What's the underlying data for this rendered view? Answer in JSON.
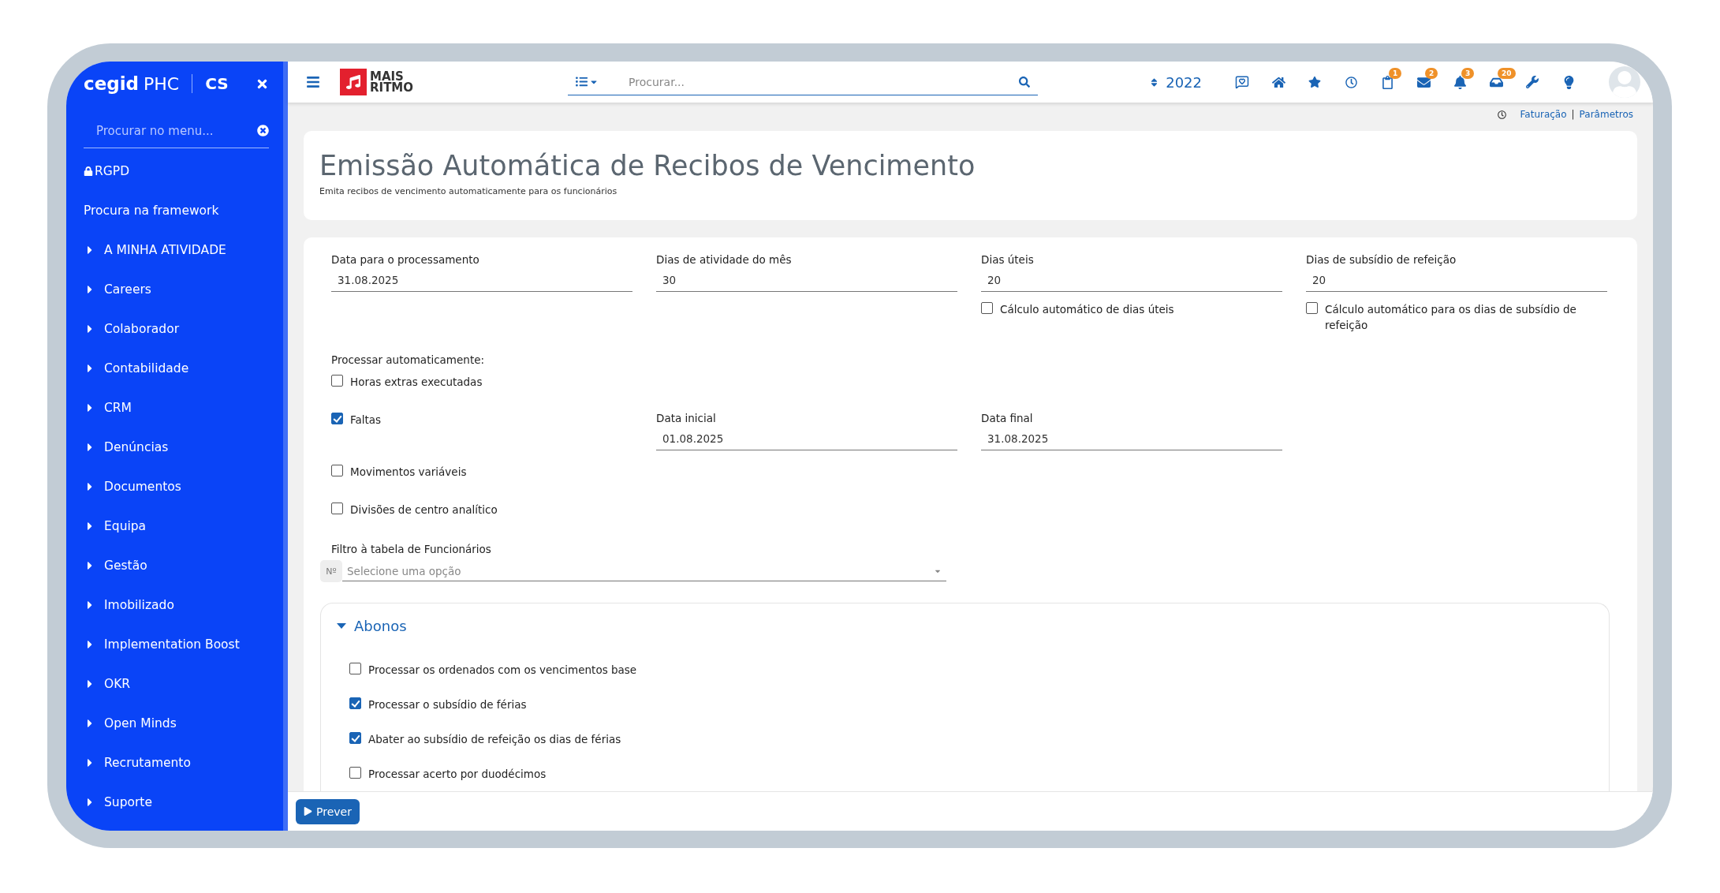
{
  "sidebar": {
    "brand": {
      "name": "cegid",
      "product": "PHC",
      "edition": "CS"
    },
    "search": {
      "placeholder": "Procurar no menu..."
    },
    "items": [
      {
        "label": "RGPD",
        "kind": "locked"
      },
      {
        "label": "Procura na framework",
        "kind": "link"
      },
      {
        "label": "A MINHA ATIVIDADE",
        "kind": "group",
        "expanded": false
      },
      {
        "label": "Careers",
        "kind": "group",
        "expanded": false
      },
      {
        "label": "Colaborador",
        "kind": "group",
        "expanded": false
      },
      {
        "label": "Contabilidade",
        "kind": "group",
        "expanded": false
      },
      {
        "label": "CRM",
        "kind": "group",
        "expanded": false
      },
      {
        "label": "Denúncias",
        "kind": "group",
        "expanded": false
      },
      {
        "label": "Documentos",
        "kind": "group",
        "expanded": false
      },
      {
        "label": "Equipa",
        "kind": "group",
        "expanded": false
      },
      {
        "label": "Gestão",
        "kind": "group",
        "expanded": false
      },
      {
        "label": "Imobilizado",
        "kind": "group",
        "expanded": false
      },
      {
        "label": "Implementation Boost",
        "kind": "group",
        "expanded": false
      },
      {
        "label": "OKR",
        "kind": "group",
        "expanded": false
      },
      {
        "label": "Open Minds",
        "kind": "group",
        "expanded": false
      },
      {
        "label": "Recrutamento",
        "kind": "group",
        "expanded": false
      },
      {
        "label": "Suporte",
        "kind": "group",
        "expanded": false
      }
    ]
  },
  "topbar": {
    "logo": {
      "line_1": "MAIS",
      "line_2": "RITMO"
    },
    "search": {
      "placeholder": "Procurar..."
    },
    "year": "2022",
    "icons": [
      {
        "kind": "message"
      },
      {
        "kind": "home"
      },
      {
        "kind": "star"
      },
      {
        "kind": "clock"
      },
      {
        "kind": "clipboard",
        "badge": "1"
      },
      {
        "kind": "mail",
        "badge": "2"
      },
      {
        "kind": "bell",
        "badge": "3"
      },
      {
        "kind": "inbox",
        "badge": "20"
      },
      {
        "kind": "wrench"
      },
      {
        "kind": "bulb"
      }
    ]
  },
  "breadcrumb": {
    "links": [
      "Faturação",
      "Parâmetros"
    ],
    "separator": "|"
  },
  "header": {
    "title": "Emissão Automática de Recibos de Vencimento",
    "subtitle": "Emita recibos de vencimento automaticamente para os funcionários"
  },
  "form": {
    "fields": [
      {
        "label": "Data para o processamento",
        "value": "31.08.2025"
      },
      {
        "label": "Dias de atividade do mês",
        "value": "30"
      },
      {
        "label": "Dias úteis",
        "value": "20",
        "option": {
          "label": "Cálculo automático de dias úteis",
          "checked": false
        }
      },
      {
        "label": "Dias de subsídio de refeição",
        "value": "20",
        "option": {
          "label": "Cálculo automático para os dias de subsídio de refeição",
          "checked": false
        }
      }
    ],
    "process_label": "Processar automaticamente:",
    "process_items": [
      {
        "label": "Horas extras executadas",
        "checked": false
      },
      {
        "label": "Faltas",
        "checked": true,
        "date_fields": [
          {
            "label": "Data inicial",
            "value": "01.08.2025"
          },
          {
            "label": "Data final",
            "value": "31.08.2025"
          }
        ]
      },
      {
        "label": "Movimentos variáveis",
        "checked": false
      },
      {
        "label": "Divisões de centro analítico",
        "checked": false
      }
    ],
    "filter": {
      "label": "Filtro à tabela de Funcionários",
      "prefix": "Nº",
      "placeholder": "Selecione uma opção"
    },
    "section": {
      "title": "Abonos",
      "expanded": true,
      "items": [
        {
          "label": "Processar os ordenados com os vencimentos base",
          "checked": false
        },
        {
          "label": "Processar o subsídio de férias",
          "checked": true
        },
        {
          "label": "Abater ao subsídio de refeição os dias de férias",
          "checked": true
        },
        {
          "label": "Processar acerto por duodécimos",
          "checked": false
        }
      ]
    }
  },
  "footer": {
    "button": "Prever"
  }
}
